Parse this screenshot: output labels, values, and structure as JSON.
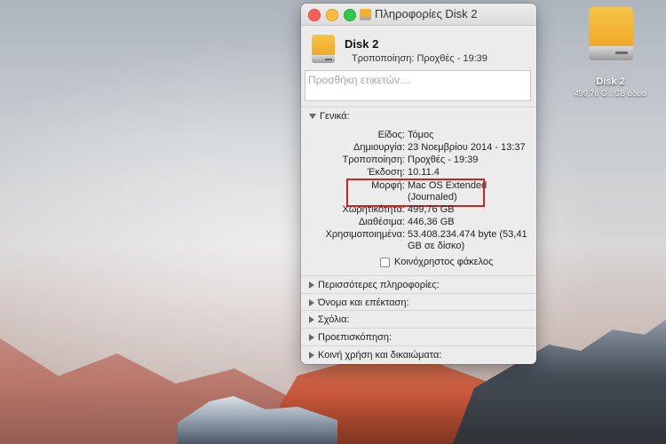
{
  "window": {
    "title": "Πληροφορίες Disk 2",
    "disk_name": "Disk 2",
    "modified_line": "Τροποποίηση: Προχθές - 19:39"
  },
  "tags": {
    "placeholder": "Προσθήκη ετικετών…"
  },
  "general": {
    "heading": "Γενικά:",
    "rows": [
      {
        "key": "Είδος:",
        "value": "Τόμος"
      },
      {
        "key": "Δημιουργία:",
        "value": "23 Νοεμβρίου 2014 - 13:37"
      },
      {
        "key": "Τροποποίηση:",
        "value": "Προχθές - 19:39"
      },
      {
        "key": "Έκδοση:",
        "value": "10.11.4"
      },
      {
        "key": "Μορφή:",
        "value": "Mac OS Extended (Journaled)"
      },
      {
        "key": "Χωρητικότητα:",
        "value": "499,76 GB"
      },
      {
        "key": "Διαθέσιμα:",
        "value": "446,36 GB"
      },
      {
        "key": "Χρησιμοποιημένα:",
        "value": "53.408.234.474 byte (53,41 GB σε δίσκο)"
      }
    ],
    "shared_folder_label": "Κοινόχρηστος φάκελος",
    "shared_folder_checked": false
  },
  "sections": [
    "Περισσότερες πληροφορίες:",
    "Όνομα και επέκταση:",
    "Σχόλια:",
    "Προεπισκόπηση:",
    "Κοινή χρήση και δικαιώματα:"
  ],
  "desktop_icon": {
    "name": "Disk 2",
    "subtitle": "499,76 G...GB άδεια"
  },
  "colors": {
    "disk_orange": "#f0b032",
    "highlight_red": "#d1241c",
    "traffic_close": "#fc605c",
    "traffic_min": "#fdbc40",
    "traffic_zoom": "#34c84a"
  }
}
